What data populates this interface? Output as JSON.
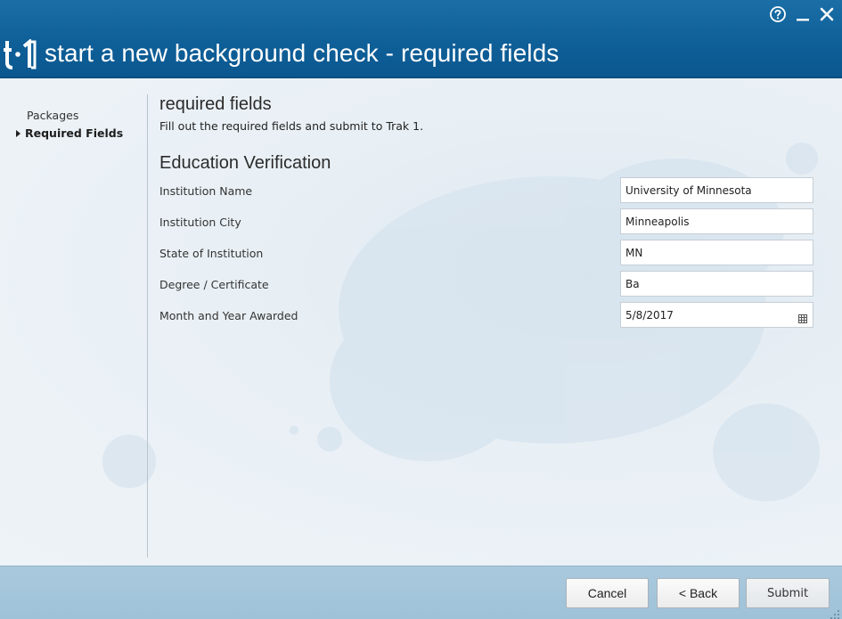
{
  "window": {
    "title": "start a new background check - required fields",
    "controls": [
      "help-icon",
      "minimize-icon",
      "close-icon"
    ],
    "accent_color": "#0f5f98"
  },
  "logo": {
    "icon": "trak1-logo"
  },
  "sidebar": {
    "items": [
      {
        "label": "Packages",
        "active": false
      },
      {
        "label": "Required Fields",
        "active": true
      }
    ]
  },
  "main": {
    "title": "required fields",
    "subtitle": "Fill out the required fields and submit to Trak 1.",
    "section": {
      "title": "Education Verification",
      "fields": [
        {
          "label": "Institution Name",
          "value": "University of Minnesota"
        },
        {
          "label": "Institution City",
          "value": "Minneapolis"
        },
        {
          "label": "State of Institution",
          "value": "MN"
        },
        {
          "label": "Degree / Certificate",
          "value": "Ba"
        },
        {
          "label": "Month and Year Awarded",
          "value": "5/8/2017",
          "icon": "calendar-icon"
        }
      ]
    }
  },
  "footer": {
    "cancel_label": "Cancel",
    "back_label": "< Back",
    "submit_label": "Submit"
  }
}
